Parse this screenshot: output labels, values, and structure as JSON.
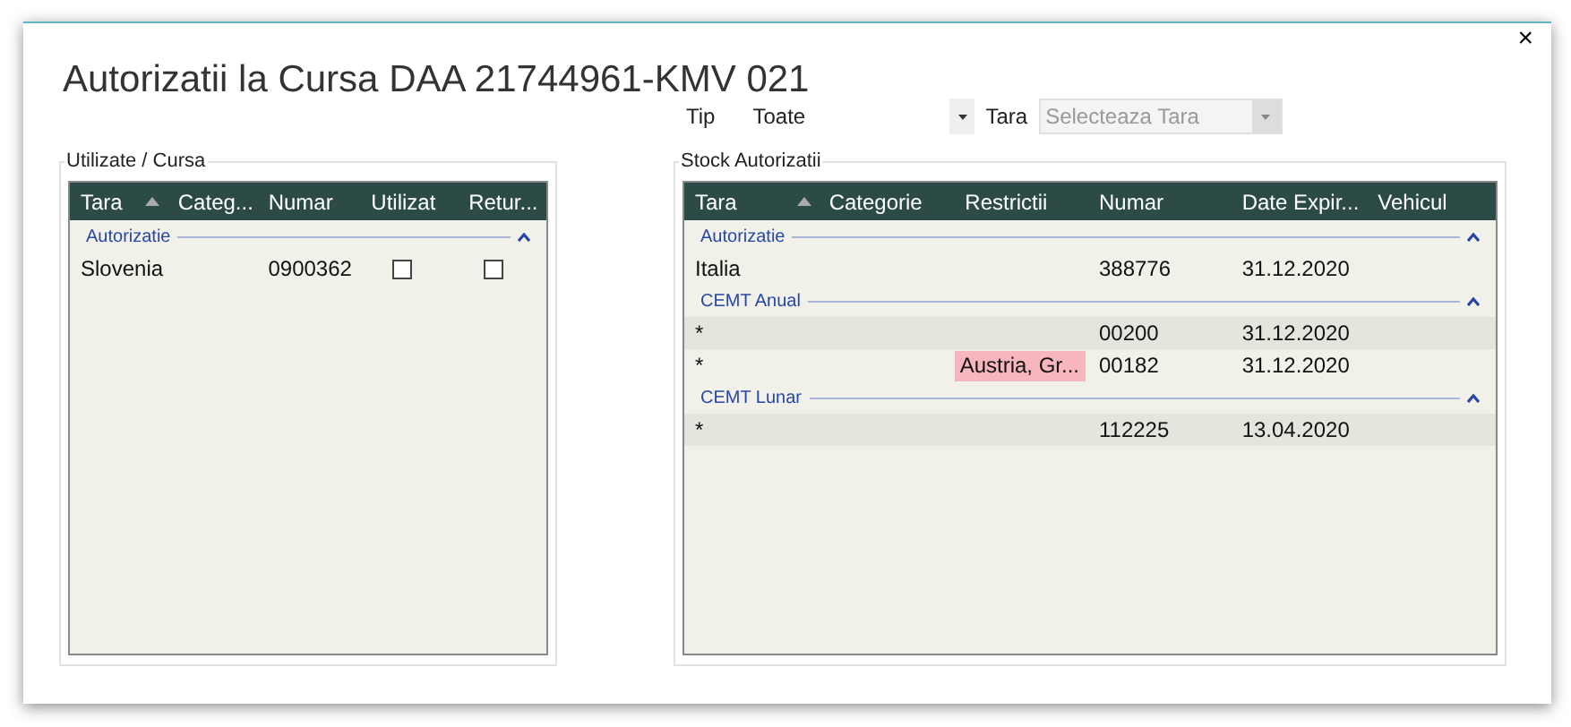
{
  "window": {
    "title": "Autorizatii la Cursa DAA 21744961-KMV 021",
    "close": "×"
  },
  "filters": {
    "tip_label": "Tip",
    "tip_value": "Toate",
    "tara_label": "Tara",
    "tara_placeholder": "Selecteaza Tara"
  },
  "used_panel": {
    "legend": "Utilizate / Cursa",
    "columns": [
      {
        "label": "Tara",
        "sorted": true
      },
      {
        "label": "Categ...",
        "sorted": false
      },
      {
        "label": "Numar",
        "sorted": false
      },
      {
        "label": "Utilizat",
        "sorted": false
      },
      {
        "label": "Retur...",
        "sorted": false
      }
    ],
    "groups": [
      {
        "label": "Autorizatie",
        "expanded": true,
        "rows": [
          {
            "tara": "Slovenia",
            "numar": "0900362",
            "utilizat": false,
            "returnat": false,
            "alternate": false
          }
        ]
      }
    ]
  },
  "stock_panel": {
    "legend": "Stock Autorizatii",
    "columns": [
      {
        "label": "Tara",
        "sorted": true
      },
      {
        "label": "Categorie",
        "sorted": false
      },
      {
        "label": "Restrictii",
        "sorted": false
      },
      {
        "label": "Numar",
        "sorted": false
      },
      {
        "label": "Date Expir...",
        "sorted": false
      },
      {
        "label": "Vehicul",
        "sorted": false
      }
    ],
    "groups": [
      {
        "label": "Autorizatie",
        "expanded": true,
        "rows": [
          {
            "tara": "Italia",
            "numar": "388776",
            "date": "31.12.2020",
            "alternate": false
          }
        ]
      },
      {
        "label": "CEMT Anual",
        "expanded": true,
        "rows": [
          {
            "tara": "*",
            "numar": "00200",
            "date": "31.12.2020",
            "alternate": true
          },
          {
            "tara": "*",
            "restrictii": "Austria, Gr...",
            "restricted": true,
            "numar": "00182",
            "date": "31.12.2020",
            "alternate": false
          }
        ]
      },
      {
        "label": "CEMT Lunar",
        "expanded": true,
        "rows": [
          {
            "tara": "*",
            "numar": "112225",
            "date": "13.04.2020",
            "alternate": true
          }
        ]
      }
    ]
  }
}
